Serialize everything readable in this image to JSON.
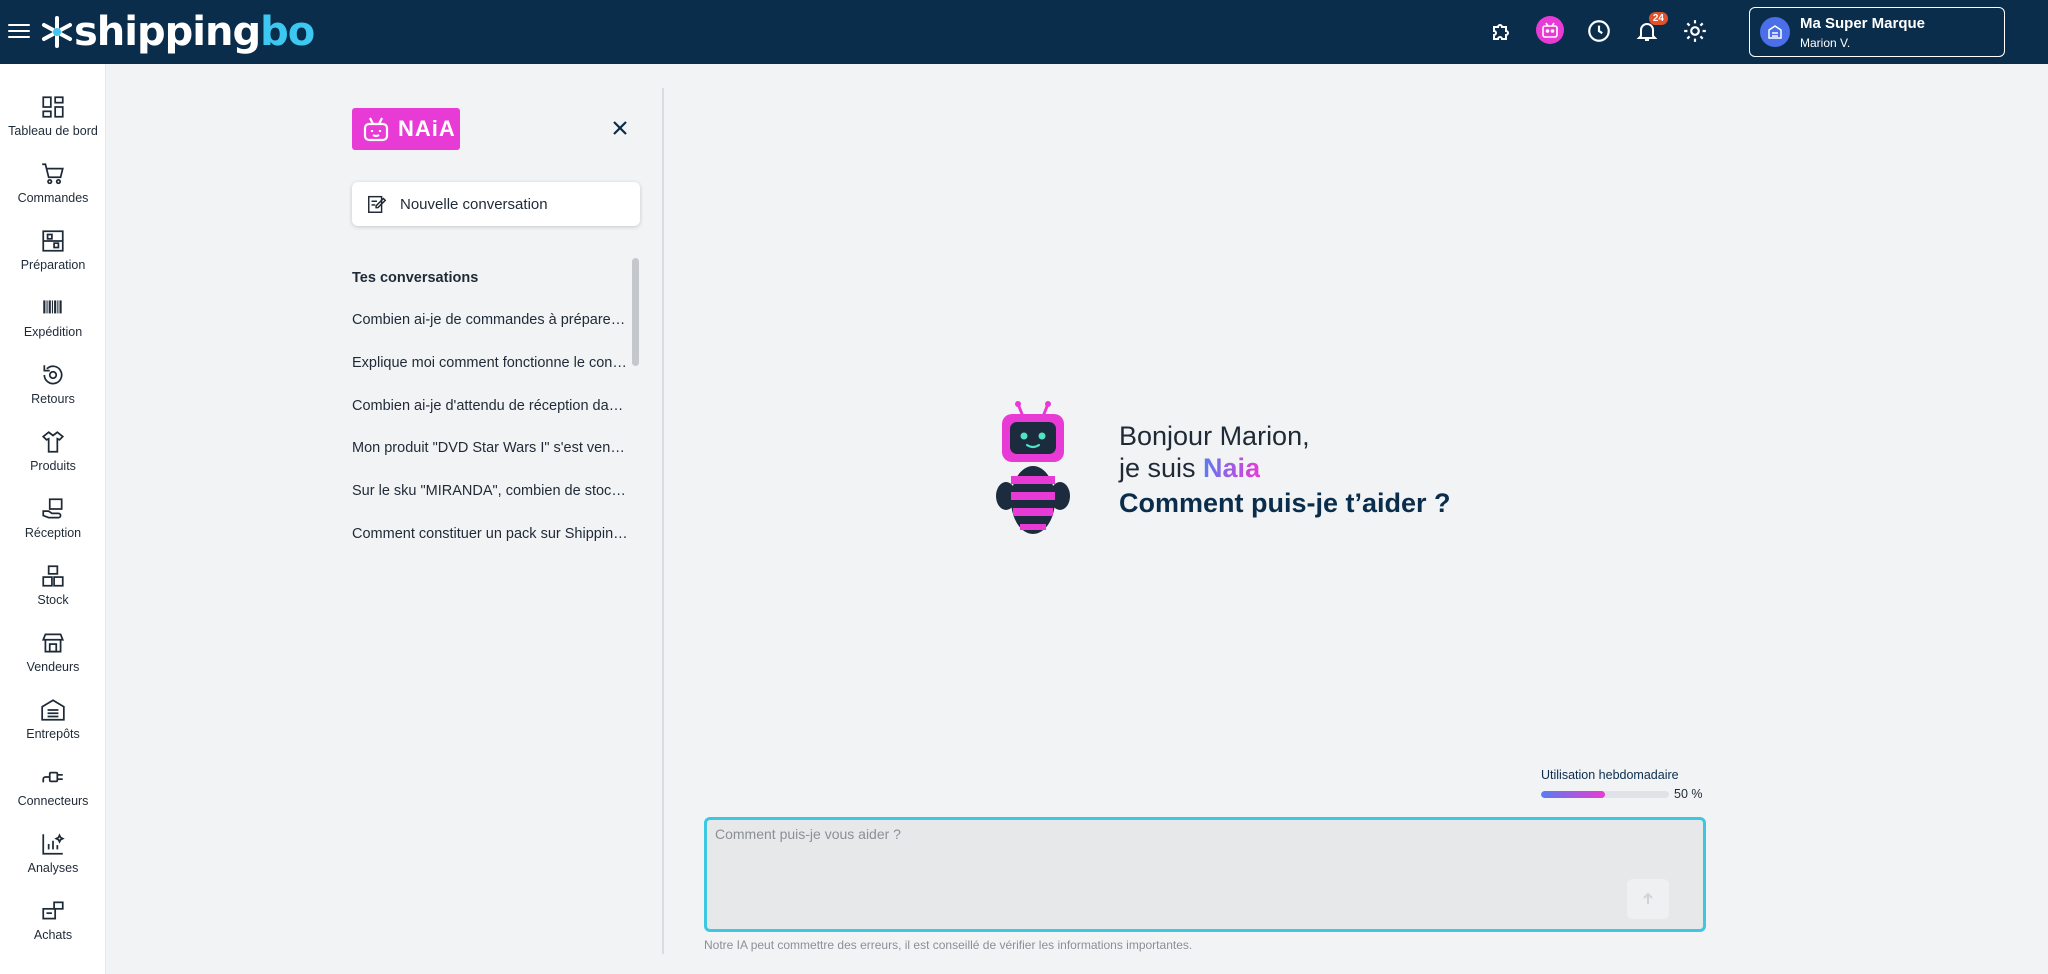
{
  "header": {
    "logo": {
      "prefix": "shipping",
      "suffix": "bo"
    },
    "icons": [
      "puzzle-icon",
      "naia-icon",
      "history-icon",
      "bell-icon",
      "gear-icon"
    ],
    "notification_count": "24",
    "account": {
      "name": "Ma Super Marque",
      "user": "Marion V."
    }
  },
  "sidebar": {
    "items": [
      {
        "label": "Tableau de bord",
        "icon": "dashboard-icon"
      },
      {
        "label": "Commandes",
        "icon": "cart-icon"
      },
      {
        "label": "Préparation",
        "icon": "preparation-icon"
      },
      {
        "label": "Expédition",
        "icon": "barcode-icon"
      },
      {
        "label": "Retours",
        "icon": "return-icon"
      },
      {
        "label": "Produits",
        "icon": "shirt-icon"
      },
      {
        "label": "Réception",
        "icon": "reception-icon"
      },
      {
        "label": "Stock",
        "icon": "stock-icon"
      },
      {
        "label": "Vendeurs",
        "icon": "store-icon"
      },
      {
        "label": "Entrepôts",
        "icon": "warehouse-icon"
      },
      {
        "label": "Connecteurs",
        "icon": "plug-icon"
      },
      {
        "label": "Analyses",
        "icon": "chart-icon"
      },
      {
        "label": "Achats",
        "icon": "purchases-icon"
      }
    ]
  },
  "panel": {
    "logo_text": "NAiA",
    "new_conversation": "Nouvelle conversation",
    "conversations_title": "Tes conversations",
    "conversations": [
      "Combien ai-je de commandes à préparer aujourd'hui ?",
      "Explique moi comment fonctionne le connecteur",
      "Combien ai-je d'attendu de réception dans la semaine ?",
      "Mon produit \"DVD Star Wars I\" s'est vendu combien de fois ?",
      "Sur le sku \"MIRANDA\", combien de stock reste-t-il ?",
      "Comment constituer un pack sur Shippingbo ?"
    ]
  },
  "greeting": {
    "line1": "Bonjour Marion,",
    "line2_prefix": "je suis ",
    "name": "Naia",
    "line3": "Comment puis-je t’aider ?"
  },
  "usage": {
    "label": "Utilisation hebdomadaire",
    "percent_text": "50 %",
    "fraction": 0.5
  },
  "chat": {
    "placeholder": "Comment puis-je vous aider ?",
    "disclaimer": "Notre IA peut commettre des erreurs, il est conseillé de vérifier les informations importantes."
  },
  "colors": {
    "header_bg": "#0b2d4c",
    "naia_pink": "#e83bd5",
    "accent_blue": "#3cc8e0"
  }
}
